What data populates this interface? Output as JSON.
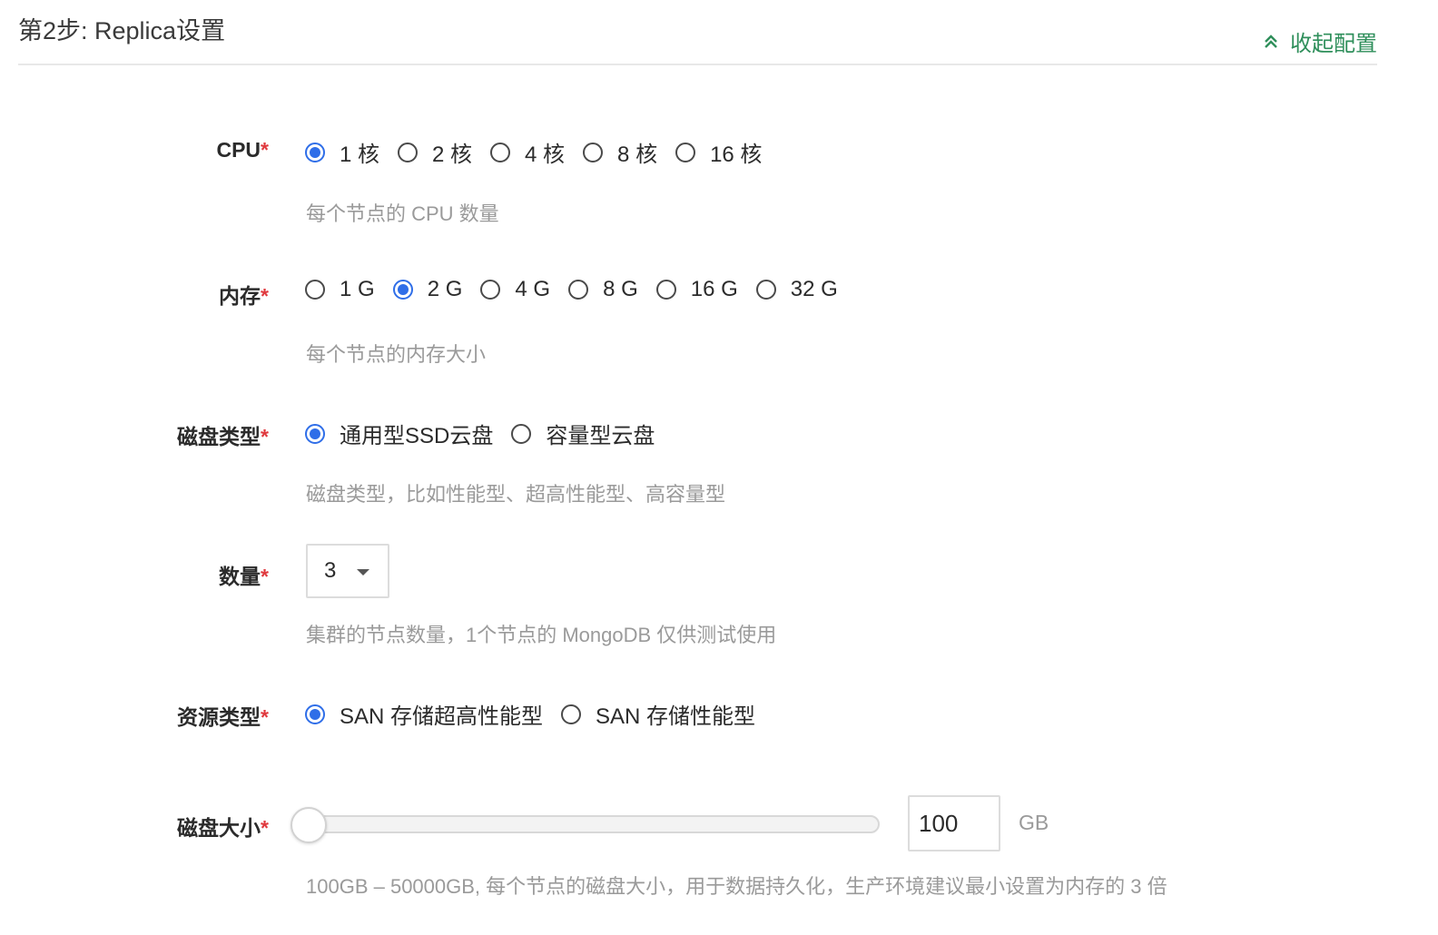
{
  "header": {
    "title": "第2步: Replica设置",
    "collapse_label": "收起配置"
  },
  "colors": {
    "accent_green": "#2f8f5b",
    "radio_blue": "#2f6ee8",
    "required_red": "#e0393e"
  },
  "cpu": {
    "label": "CPU",
    "required_mark": "*",
    "options": [
      "1 核",
      "2 核",
      "4 核",
      "8 核",
      "16 核"
    ],
    "selected": "1 核",
    "hint": "每个节点的 CPU 数量"
  },
  "memory": {
    "label": "内存",
    "required_mark": "*",
    "options": [
      "1 G",
      "2 G",
      "4 G",
      "8 G",
      "16 G",
      "32 G"
    ],
    "selected": "2 G",
    "hint": "每个节点的内存大小"
  },
  "disk_type": {
    "label": "磁盘类型",
    "required_mark": "*",
    "options": [
      "通用型SSD云盘",
      "容量型云盘"
    ],
    "selected": "通用型SSD云盘",
    "hint": "磁盘类型，比如性能型、超高性能型、高容量型"
  },
  "count": {
    "label": "数量",
    "required_mark": "*",
    "value": "3",
    "hint": "集群的节点数量，1个节点的 MongoDB 仅供测试使用"
  },
  "resource_type": {
    "label": "资源类型",
    "required_mark": "*",
    "options": [
      "SAN 存储超高性能型",
      "SAN 存储性能型"
    ],
    "selected": "SAN 存储超高性能型"
  },
  "disk_size": {
    "label": "磁盘大小",
    "required_mark": "*",
    "value": "100",
    "unit": "GB",
    "min": 100,
    "max": 50000,
    "slider_fraction": 0,
    "hint": "100GB – 50000GB, 每个节点的磁盘大小，用于数据持久化，生产环境建议最小设置为内存的 3 倍"
  }
}
